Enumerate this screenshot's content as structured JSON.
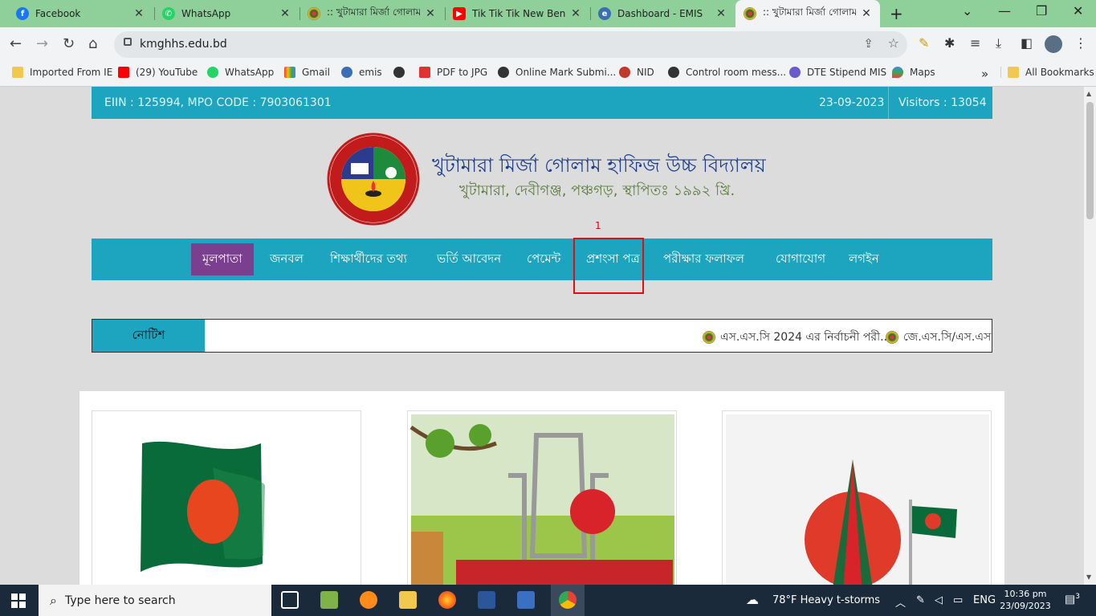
{
  "browser": {
    "tabs": [
      {
        "title": "Facebook",
        "icon": "facebook-icon",
        "color": "#1877f2"
      },
      {
        "title": "WhatsApp",
        "icon": "whatsapp-icon",
        "color": "#25d366"
      },
      {
        "title": ":: খুটামারা মির্জা গোলাম",
        "icon": "school-logo-icon",
        "color": "#2b3c8f"
      },
      {
        "title": "Tik Tik Tik New Benga",
        "icon": "youtube-icon",
        "color": "#ff0000"
      },
      {
        "title": "Dashboard - EMIS",
        "icon": "emis-icon",
        "color": "#3a6fb5"
      },
      {
        "title": ":: খুটামারা মির্জা গোলাম",
        "icon": "school-logo-icon",
        "color": "#2b3c8f",
        "active": true
      }
    ],
    "url": "kmghhs.edu.bd",
    "bookmarks": [
      {
        "label": "Imported From IE",
        "icon": "folder-icon"
      },
      {
        "label": "(29) YouTube",
        "icon": "youtube-icon"
      },
      {
        "label": "WhatsApp",
        "icon": "whatsapp-icon"
      },
      {
        "label": "Gmail",
        "icon": "gmail-icon"
      },
      {
        "label": "emis",
        "icon": "emis-icon"
      },
      {
        "label": "",
        "icon": "globe-icon"
      },
      {
        "label": "PDF to JPG",
        "icon": "pdf-icon"
      },
      {
        "label": "Online Mark Submi...",
        "icon": "globe-icon"
      },
      {
        "label": "NID",
        "icon": "nid-icon"
      },
      {
        "label": "Control room mess...",
        "icon": "globe-icon"
      },
      {
        "label": "DTE Stipend MIS",
        "icon": "dte-icon"
      },
      {
        "label": "Maps",
        "icon": "maps-icon"
      }
    ],
    "bookmarks_more": "»",
    "all_bookmarks": "All Bookmarks"
  },
  "site": {
    "eiin": "EIIN : 125994, MPO CODE : 7903061301",
    "date": "23-09-2023",
    "visitors": "Visitors : 13054",
    "school_name": "খুটামারা মির্জা গোলাম হাফিজ উচ্চ বিদ্যালয়",
    "school_address": "খুটামারা, দেবীগঞ্জ, পঞ্চগড়, স্থাপিতঃ ১৯৯২ খ্রি.",
    "nav": [
      "মূলপাতা",
      "জনবল",
      "শিক্ষার্থীদের তথ্য",
      "ভর্তি আবেদন",
      "পেমেন্ট",
      "প্রশংসা পত্র",
      "পরীক্ষার ফলাফল",
      "যোগাযোগ",
      "লগইন"
    ],
    "highlight_number": "1",
    "notice_label": "নোটিশ",
    "notices": [
      "এস.এস.সি 2024 এর নির্বাচনী পরী...",
      "জে.এস.সি/এস.এস.সি"
    ]
  },
  "taskbar": {
    "search_placeholder": "Type here to search",
    "weather": "78°F  Heavy t-storms",
    "lang": "ENG",
    "time": "10:36 pm",
    "date": "23/09/2023",
    "notifications": "3"
  }
}
